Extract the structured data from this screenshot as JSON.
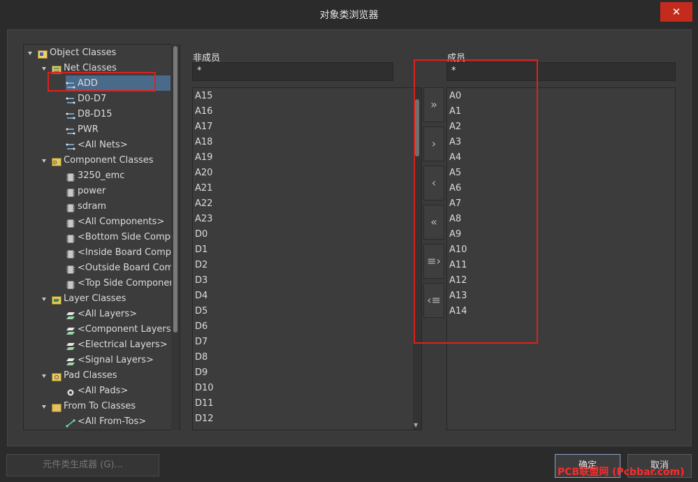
{
  "window": {
    "title": "对象类浏览器",
    "close_label": "✕"
  },
  "tree": {
    "items": [
      {
        "label": "Object Classes",
        "level": 0,
        "expanded": true,
        "icon": "object-classes-icon"
      },
      {
        "label": "Net Classes",
        "level": 1,
        "expanded": true,
        "icon": "net-classes-icon"
      },
      {
        "label": "ADD",
        "level": 2,
        "icon": "net-icon",
        "selected": true
      },
      {
        "label": "D0-D7",
        "level": 2,
        "icon": "net-icon"
      },
      {
        "label": "D8-D15",
        "level": 2,
        "icon": "net-icon"
      },
      {
        "label": "PWR",
        "level": 2,
        "icon": "net-icon"
      },
      {
        "label": "<All Nets>",
        "level": 2,
        "icon": "net-icon"
      },
      {
        "label": "Component Classes",
        "level": 1,
        "expanded": true,
        "icon": "component-classes-icon"
      },
      {
        "label": "3250_emc",
        "level": 2,
        "icon": "component-icon"
      },
      {
        "label": "power",
        "level": 2,
        "icon": "component-icon"
      },
      {
        "label": "sdram",
        "level": 2,
        "icon": "component-icon"
      },
      {
        "label": "<All Components>",
        "level": 2,
        "icon": "component-icon"
      },
      {
        "label": "<Bottom Side Compo",
        "level": 2,
        "icon": "component-icon"
      },
      {
        "label": "<Inside Board Compo",
        "level": 2,
        "icon": "component-icon"
      },
      {
        "label": "<Outside Board Com",
        "level": 2,
        "icon": "component-icon"
      },
      {
        "label": "<Top Side Componer",
        "level": 2,
        "icon": "component-icon"
      },
      {
        "label": "Layer Classes",
        "level": 1,
        "expanded": true,
        "icon": "layer-classes-icon"
      },
      {
        "label": "<All Layers>",
        "level": 2,
        "icon": "layer-icon"
      },
      {
        "label": "<Component Layers>",
        "level": 2,
        "icon": "layer-icon"
      },
      {
        "label": "<Electrical Layers>",
        "level": 2,
        "icon": "layer-icon"
      },
      {
        "label": "<Signal Layers>",
        "level": 2,
        "icon": "layer-icon"
      },
      {
        "label": "Pad Classes",
        "level": 1,
        "expanded": true,
        "icon": "pad-classes-icon"
      },
      {
        "label": "<All Pads>",
        "level": 2,
        "icon": "pad-icon"
      },
      {
        "label": "From To Classes",
        "level": 1,
        "expanded": true,
        "icon": "from-to-classes-icon"
      },
      {
        "label": "<All From-Tos>",
        "level": 2,
        "icon": "from-to-icon"
      }
    ]
  },
  "non_members": {
    "header": "非成员",
    "filter": "*",
    "items": [
      "A15",
      "A16",
      "A17",
      "A18",
      "A19",
      "A20",
      "A21",
      "A22",
      "A23",
      "D0",
      "D1",
      "D2",
      "D3",
      "D4",
      "D5",
      "D6",
      "D7",
      "D8",
      "D9",
      "D10",
      "D11",
      "D12"
    ]
  },
  "members": {
    "header": "成员",
    "filter": "*",
    "items": [
      "A0",
      "A1",
      "A2",
      "A3",
      "A4",
      "A5",
      "A6",
      "A7",
      "A8",
      "A9",
      "A10",
      "A11",
      "A12",
      "A13",
      "A14"
    ]
  },
  "transfer_buttons": [
    {
      "name": "add-all-button",
      "glyph": "»"
    },
    {
      "name": "add-selected-button",
      "glyph": "›"
    },
    {
      "name": "remove-selected-button",
      "glyph": "‹"
    },
    {
      "name": "remove-all-button",
      "glyph": "«"
    },
    {
      "name": "add-filtered-button",
      "glyph": "≡›"
    },
    {
      "name": "remove-filtered-button",
      "glyph": "‹≡"
    }
  ],
  "footer": {
    "generator_label": "元件类生成器 (G)...",
    "ok_label": "确定",
    "cancel_label": "取消"
  },
  "watermark": "PCB联盟网 (Pcbbar.com)",
  "colors": {
    "highlight": "#e02020",
    "selection": "#4a6a8a",
    "close": "#c42b1c"
  }
}
